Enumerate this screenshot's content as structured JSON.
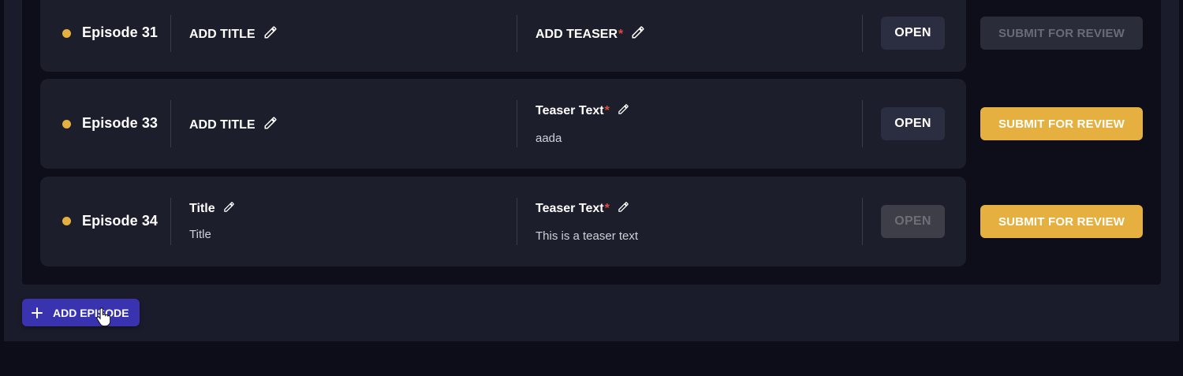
{
  "colors": {
    "accent_yellow": "#e5b040",
    "status_dot": "#e5b040",
    "primary_purple": "#3a33b0",
    "required_asterisk": "#e24a3b"
  },
  "episodes": [
    {
      "name": "Episode 31",
      "title_label": "ADD TITLE",
      "title_value": "",
      "teaser_label": "ADD TEASER",
      "teaser_required_mark": "*",
      "teaser_value": "",
      "open_label": "OPEN",
      "open_enabled": true,
      "submit_label": "SUBMIT FOR REVIEW",
      "submit_enabled": false
    },
    {
      "name": "Episode 33",
      "title_label": "ADD TITLE",
      "title_value": "",
      "teaser_label": "Teaser Text",
      "teaser_required_mark": "*",
      "teaser_value": "aada",
      "open_label": "OPEN",
      "open_enabled": true,
      "submit_label": "SUBMIT FOR REVIEW",
      "submit_enabled": true
    },
    {
      "name": "Episode 34",
      "title_label": "Title",
      "title_value": "Title",
      "teaser_label": "Teaser Text",
      "teaser_required_mark": "*",
      "teaser_value": "This is a teaser text",
      "open_label": "OPEN",
      "open_enabled": false,
      "submit_label": "SUBMIT FOR REVIEW",
      "submit_enabled": true
    }
  ],
  "add_episode": {
    "label": "ADD EPISODE",
    "icon": "plus-icon"
  },
  "cursor": {
    "icon": "hand-pointer-icon"
  }
}
